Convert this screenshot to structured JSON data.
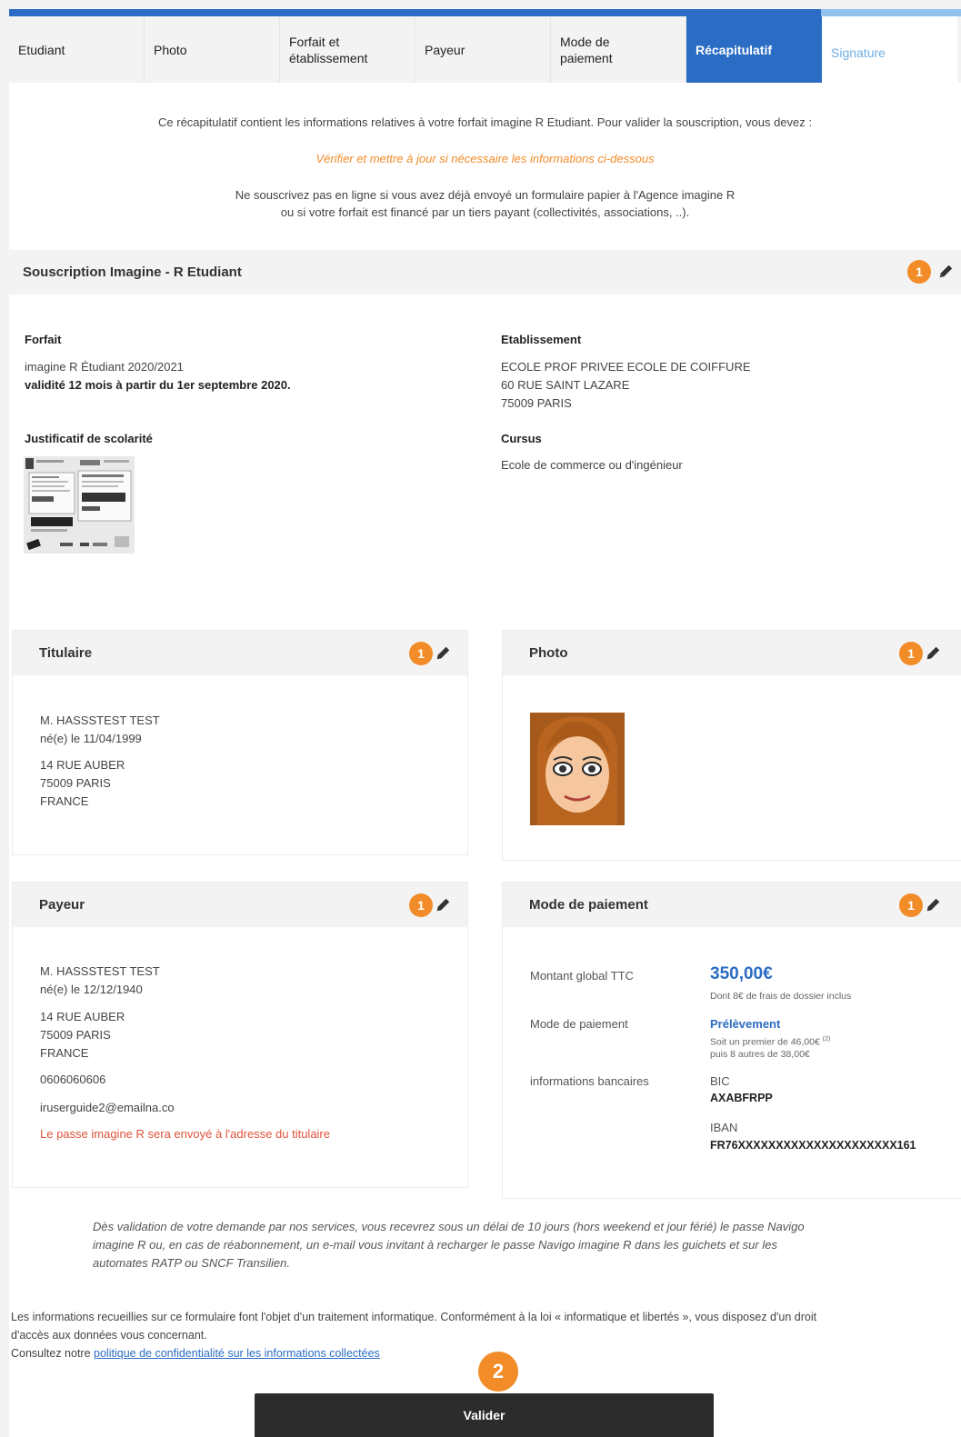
{
  "steps": [
    {
      "label": "Etudiant"
    },
    {
      "label": "Photo"
    },
    {
      "label": "Forfait et établissement"
    },
    {
      "label": "Payeur"
    },
    {
      "label": "Mode de paiement"
    },
    {
      "label": "Récapitulatif"
    },
    {
      "label": "Signature"
    }
  ],
  "progress": {
    "done_fraction": 0.853
  },
  "intro": {
    "line1": "Ce récapitulatif contient les informations relatives à votre forfait imagine R Etudiant. Pour valider la souscription, vous devez :",
    "warn": "Vérifier et mettre à jour si nécessaire les informations ci-dessous",
    "line3": "Ne souscrivez pas en ligne si vous avez déjà envoyé un formulaire papier à l'Agence imagine R",
    "line4": "ou si votre forfait est financé par un tiers payant  (collectivités, associations, ..)."
  },
  "subscription": {
    "title": "Souscription Imagine - R Etudiant",
    "badge": "1",
    "forfait_label": "Forfait",
    "forfait_name": "imagine R Étudiant 2020/2021",
    "forfait_validity": "validité 12 mois à partir du 1er septembre 2020.",
    "etab_label": "Etablissement",
    "etab_name": "ECOLE PROF PRIVEE ECOLE DE COIFFURE",
    "etab_street": "60 RUE SAINT LAZARE",
    "etab_city": "75009 PARIS",
    "justif_label": "Justificatif de scolarité",
    "cursus_label": "Cursus",
    "cursus_value": "Ecole de commerce ou d'ingénieur"
  },
  "titulaire": {
    "title": "Titulaire",
    "badge": "1",
    "name": "M. HASSSTEST TEST",
    "birth": "né(e) le 11/04/1999",
    "street": "14 RUE AUBER",
    "city": "75009 PARIS",
    "country": "FRANCE"
  },
  "photo": {
    "title": "Photo",
    "badge": "1"
  },
  "payeur": {
    "title": "Payeur",
    "badge": "1",
    "name": "M. HASSSTEST TEST",
    "birth": "né(e) le 12/12/1940",
    "street": "14 RUE AUBER",
    "city": "75009 PARIS",
    "country": "FRANCE",
    "phone": "0606060606",
    "email": "iruserguide2@emailna.co",
    "notice": "Le passe imagine R sera envoyé à l'adresse du titulaire"
  },
  "paiement": {
    "title": "Mode de paiement",
    "badge": "1",
    "total_label": "Montant global TTC",
    "total_value": "350,00€",
    "total_note": "Dont 8€ de frais de dossier inclus",
    "mode_label": "Mode de paiement",
    "mode_value": "Prélèvement",
    "mode_note1": "Soit un premier de 46,00€",
    "mode_note1_sup": "(2)",
    "mode_note2": "puis 8 autres de 38,00€",
    "bank_label": "informations bancaires",
    "bic_label": "BIC",
    "bic_value": "AXABFRPP",
    "iban_label": "IBAN",
    "iban_value": "FR76XXXXXXXXXXXXXXXXXXXXX161"
  },
  "notice": {
    "line1": "Dès validation de votre demande par nos services, vous recevrez sous un délai de 10 jours (hors weekend et jour férié) le passe Navigo",
    "line2": "imagine R ou, en cas de réabonnement, un e-mail vous invitant à recharger le passe Navigo imagine R dans les guichets et sur les",
    "line3": "automates RATP ou SNCF Transilien."
  },
  "legal": {
    "line1": "Les informations recueillies sur ce formulaire font l'objet d'un traitement informatique. Conformément à la loi « informatique et libertés », vous disposez d'un droit",
    "line2": "d'accès aux données vous concernant.",
    "line3_prefix": "Consultez notre ",
    "link": "politique de confidentialité sur les informations collectées"
  },
  "submit": {
    "label": "Valider",
    "badge": "2"
  },
  "colors": {
    "accent": "#2b6cc4",
    "badge": "#f28c28",
    "warn": "#f28c28",
    "notice_red": "#e0533b",
    "button": "#2c2c2c"
  },
  "icons": {
    "edit": "pencil-icon",
    "document_thumbnail": "document-thumbnail-icon",
    "avatar": "avatar-photo"
  }
}
